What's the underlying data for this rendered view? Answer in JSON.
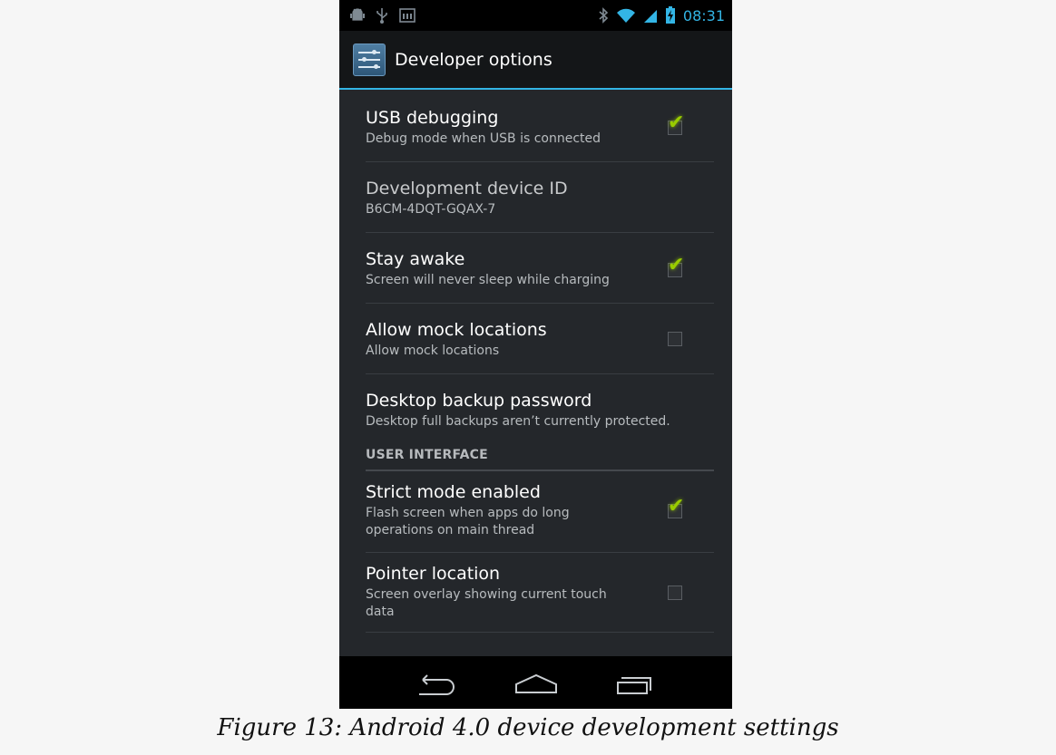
{
  "status_bar": {
    "time": "08:31",
    "left_icons": [
      "android-debug-icon",
      "usb-icon",
      "storage-icon"
    ],
    "right_icons": [
      "bluetooth-icon",
      "wifi-icon",
      "signal-icon",
      "battery-charging-icon"
    ]
  },
  "action_bar": {
    "title": "Developer options",
    "icon": "developer-options-icon"
  },
  "preferences": [
    {
      "title": "USB debugging",
      "summary": "Debug mode when USB is connected",
      "checked": true
    },
    {
      "title": "Development device ID",
      "summary": "B6CM-4DQT-GQAX-7"
    },
    {
      "title": "Stay awake",
      "summary": "Screen will never sleep while charging",
      "checked": true
    },
    {
      "title": "Allow mock locations",
      "summary": "Allow mock locations",
      "checked": false
    },
    {
      "title": "Desktop backup password",
      "summary": "Desktop full backups aren’t currently protected."
    }
  ],
  "section_header": "USER INTERFACE",
  "ui_preferences": [
    {
      "title": "Strict mode enabled",
      "summary": "Flash screen when apps do long operations on main thread",
      "checked": true
    },
    {
      "title": "Pointer location",
      "summary": "Screen overlay showing current touch data",
      "checked": false
    }
  ],
  "nav_bar": {
    "buttons": [
      "back-icon",
      "home-icon",
      "recent-apps-icon"
    ]
  },
  "caption": "Figure 13: Android 4.0 device development settings",
  "colors": {
    "accent": "#33b5e5",
    "checkmark": "#99cc00",
    "background": "#24272b"
  }
}
